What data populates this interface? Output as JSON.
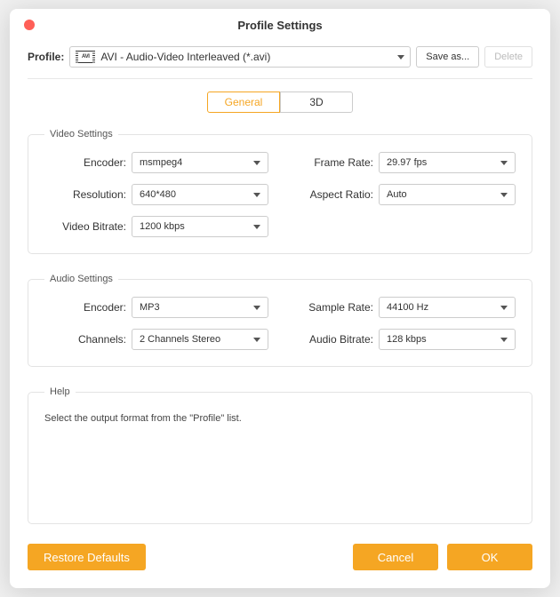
{
  "window": {
    "title": "Profile Settings"
  },
  "profile": {
    "label": "Profile:",
    "selected": "AVI - Audio-Video Interleaved (*.avi)",
    "icon_text": "AVI",
    "save_as": "Save as...",
    "delete": "Delete"
  },
  "tabs": {
    "general": "General",
    "threed": "3D"
  },
  "video": {
    "legend": "Video Settings",
    "encoder_label": "Encoder:",
    "encoder_value": "msmpeg4",
    "frame_rate_label": "Frame Rate:",
    "frame_rate_value": "29.97 fps",
    "resolution_label": "Resolution:",
    "resolution_value": "640*480",
    "aspect_label": "Aspect Ratio:",
    "aspect_value": "Auto",
    "bitrate_label": "Video Bitrate:",
    "bitrate_value": "1200 kbps"
  },
  "audio": {
    "legend": "Audio Settings",
    "encoder_label": "Encoder:",
    "encoder_value": "MP3",
    "sample_rate_label": "Sample Rate:",
    "sample_rate_value": "44100 Hz",
    "channels_label": "Channels:",
    "channels_value": "2 Channels Stereo",
    "bitrate_label": "Audio Bitrate:",
    "bitrate_value": "128 kbps"
  },
  "help": {
    "legend": "Help",
    "text": "Select the output format from the \"Profile\" list."
  },
  "buttons": {
    "restore": "Restore Defaults",
    "cancel": "Cancel",
    "ok": "OK"
  },
  "colors": {
    "accent": "#f5a623"
  }
}
